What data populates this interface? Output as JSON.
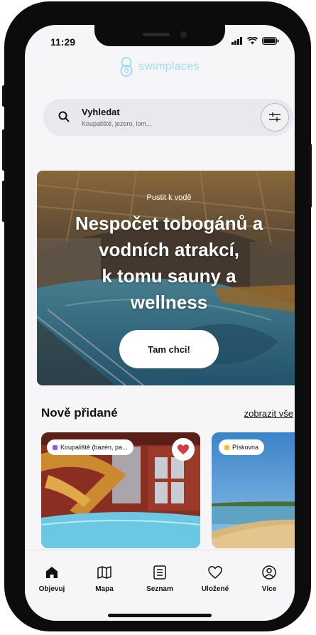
{
  "status_bar": {
    "time": "11:29"
  },
  "brand": {
    "name": "swimplaces",
    "color": "#9fdcf0"
  },
  "search": {
    "title": "Vyhledat",
    "placeholder": "Koupaliště, jezero, lom..."
  },
  "hero": {
    "kicker": "Pustit k vodě",
    "title_lines": [
      "Nespočet tobogánů a",
      "vodních atrakcí,",
      "k tomu sauny a",
      "wellness"
    ],
    "cta_label": "Tam chci!"
  },
  "section": {
    "title": "Nově přidané",
    "link_label": "zobrazit vše"
  },
  "cards": [
    {
      "category": "Koupaliště (bazén, pa...",
      "category_color": "#9b59e6",
      "favorite": true
    },
    {
      "category": "Pískovna",
      "category_color": "#f2c230",
      "favorite": false
    }
  ],
  "nav": {
    "items": [
      {
        "label": "Objevuj",
        "icon": "home-icon",
        "active": true
      },
      {
        "label": "Mapa",
        "icon": "map-icon",
        "active": false
      },
      {
        "label": "Seznam",
        "icon": "list-icon",
        "active": false
      },
      {
        "label": "Uložené",
        "icon": "heart-icon",
        "active": false
      },
      {
        "label": "Více",
        "icon": "profile-icon",
        "active": false
      }
    ]
  }
}
